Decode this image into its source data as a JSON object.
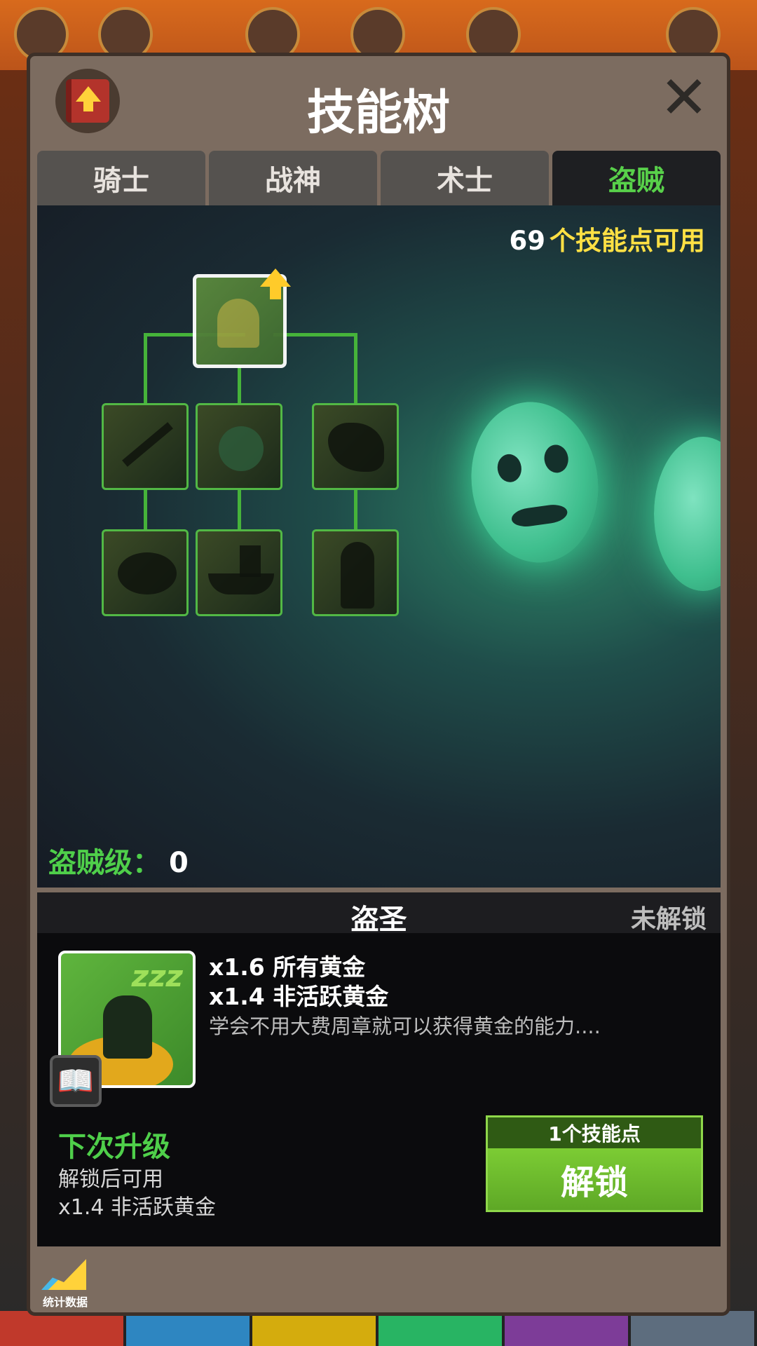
{
  "window": {
    "title": "技能树"
  },
  "tabs": [
    {
      "label": "骑士",
      "active": false
    },
    {
      "label": "战神",
      "active": false
    },
    {
      "label": "术士",
      "active": false
    },
    {
      "label": "盗贼",
      "active": true
    }
  ],
  "skill_points": {
    "count": "69",
    "label": "个技能点可用"
  },
  "tree": {
    "level_label": "盗贼级：",
    "level_value": "0"
  },
  "icons": {
    "book_upgrade": "book-upgrade-icon",
    "close": "close-icon",
    "info_book": "book-icon",
    "stats": "stats-chart-icon"
  },
  "detail": {
    "name": "盗圣",
    "status": "未解锁",
    "stats": [
      "x1.6 所有黄金",
      "x1.4 非活跃黄金"
    ],
    "description": "学会不用大费周章就可以获得黄金的能力....",
    "next_title": "下次升级",
    "next_lines": [
      "解锁后可用",
      "x1.4 非活跃黄金"
    ],
    "unlock_cost": "1个技能点",
    "unlock_label": "解锁"
  },
  "stats_button": {
    "label": "统计数据"
  },
  "colors": {
    "accent_green": "#4fcf4a",
    "points_yellow": "#ffe044",
    "panel": "#7c6c60"
  }
}
